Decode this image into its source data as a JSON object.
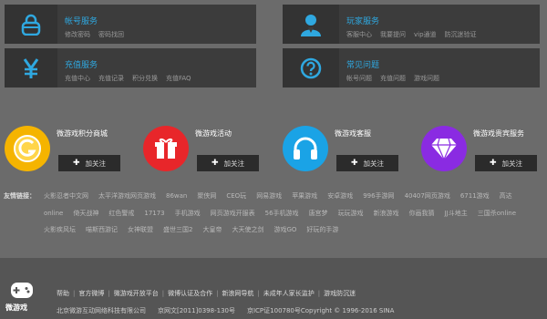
{
  "services": [
    {
      "title": "帐号服务",
      "links": [
        "修改密码",
        "密码找回"
      ],
      "icon": "lock-icon"
    },
    {
      "title": "玩家服务",
      "links": [
        "客服中心",
        "我要提问",
        "vip通道",
        "防沉迷验证"
      ],
      "icon": "user-icon"
    },
    {
      "title": "充值服务",
      "links": [
        "充值中心",
        "充值记录",
        "积分兑换",
        "充值FAQ"
      ],
      "icon": "yuan-icon"
    },
    {
      "title": "常见问题",
      "links": [
        "帐号问题",
        "充值问题",
        "游戏问题"
      ],
      "icon": "question-icon"
    }
  ],
  "features": [
    {
      "title": "微游戏积分商城",
      "button": "加关注",
      "color": "#f5b400",
      "icon": "g-coin-icon"
    },
    {
      "title": "微游戏活动",
      "button": "加关注",
      "color": "#e8262a",
      "icon": "gift-icon"
    },
    {
      "title": "微游戏客服",
      "button": "加关注",
      "color": "#1aa3e6",
      "icon": "headphones-icon"
    },
    {
      "title": "微游戏贵宾服务",
      "button": "加关注",
      "color": "#8a2be2",
      "icon": "diamond-icon"
    }
  ],
  "friend_links": {
    "label": "友情链接：",
    "rows": [
      [
        "火影忍者中文网",
        "太平洋游戏网页游戏",
        "86wan",
        "聚侠网",
        "CEO玩",
        "网易游戏",
        "苹果游戏",
        "安卓游戏",
        "996手游网",
        "40407网页游戏",
        "6711游戏",
        "高达"
      ],
      [
        "online",
        "倚天战神",
        "红色警戒",
        "17173",
        "手机游戏",
        "网页游戏开服表",
        "56手机游戏",
        "唐宫梦",
        "玩玩游戏",
        "新浪游戏",
        "你画我猜",
        "JJ斗地主",
        "三国杀online"
      ],
      [
        "火影疾风坛",
        "喵斯西游记",
        "女神联盟",
        "盛世三国2",
        "大皇帝",
        "大天使之剑",
        "游戏GO",
        "好玩的手游"
      ]
    ]
  },
  "footer": {
    "logo_text": "微游戏",
    "nav": [
      "帮助",
      "官方微博",
      "微游戏开放平台",
      "微博认证及合作",
      "新浪网导航",
      "未成年人家长监护",
      "游戏防沉迷"
    ],
    "copyright": [
      "北京微游互动网络科技有限公司",
      "京网文[2011]0398-130号",
      "京ICP证100780号Copyright © 1996-2016 SINA"
    ]
  }
}
